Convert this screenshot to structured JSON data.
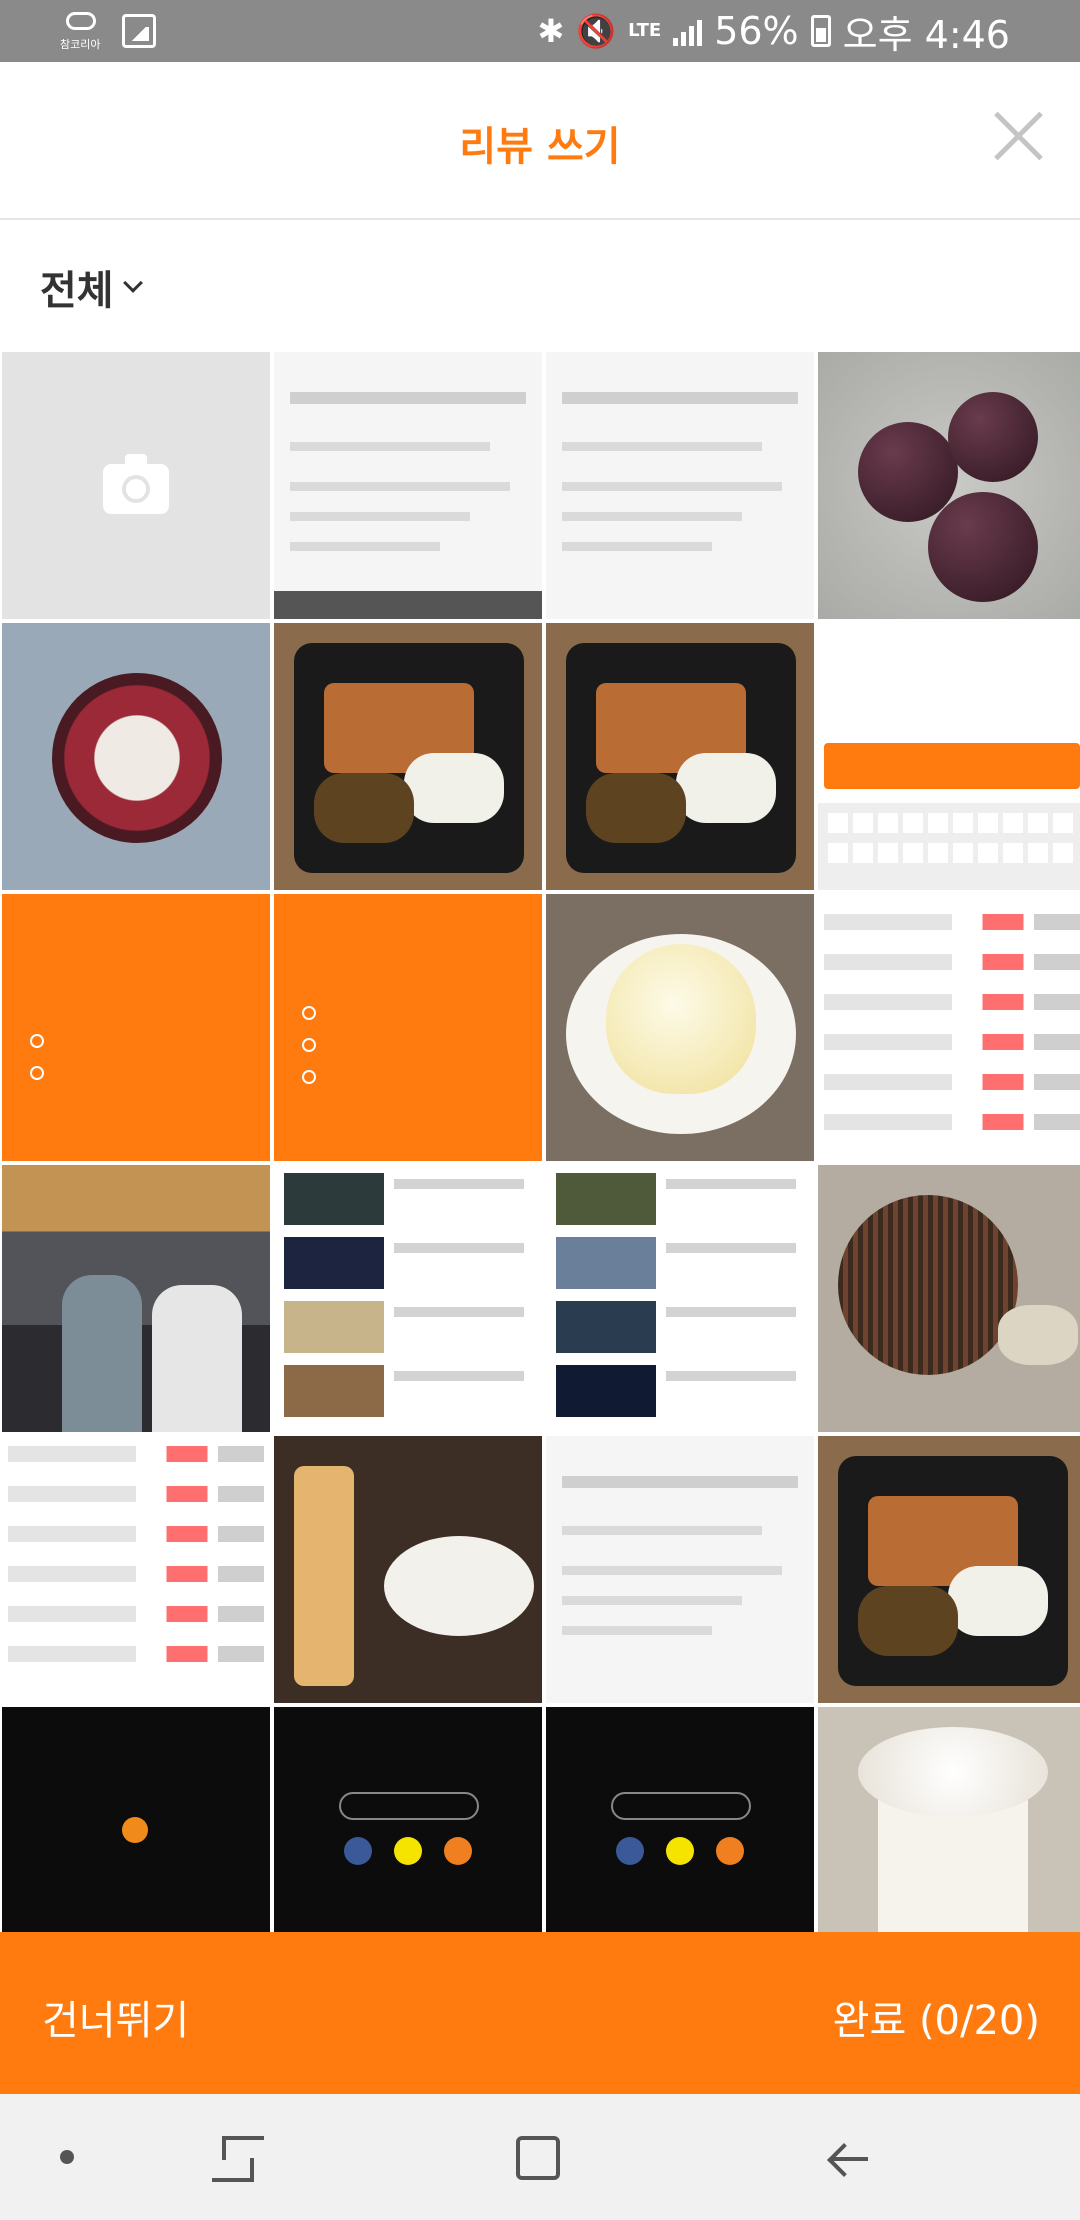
{
  "status_bar": {
    "carrier_label": "참코리아",
    "battery": "56%",
    "network": "LTE",
    "time": "오후 4:46",
    "icons": [
      "carrier-icon",
      "gallery-icon",
      "bluetooth-icon",
      "mute-icon",
      "lte-icon",
      "signal-icon",
      "battery-icon"
    ]
  },
  "header": {
    "title": "리뷰 쓰기",
    "close_icon": "close-icon"
  },
  "filter": {
    "label": "전체",
    "icon": "chevron-down-icon"
  },
  "grid": {
    "columns": 4,
    "tiles": [
      "camera",
      "news-article-screenshot",
      "stock-app-screenshot",
      "mangosteen-photo",
      "mangosteen-open-photo",
      "katsu-curry-photo",
      "katsu-curry-photo",
      "app-keyboard-screenshot",
      "orange-menu-screenshot",
      "orange-menu-screenshot",
      "dessert-photo",
      "crypto-list-screenshot",
      "restaurant-crowd-photo",
      "video-list-screenshot",
      "video-list-screenshot",
      "bbq-grill-photo",
      "board-list-screenshot",
      "cafe-dessert-photo",
      "stock-app-screenshot",
      "katsu-curry-photo",
      "dark-app-screenshot",
      "dark-app-screenshot",
      "dark-app-screenshot",
      "frappe-photo"
    ]
  },
  "actions": {
    "skip_label": "건너뛰기",
    "done_label": "완료 (0/20)"
  },
  "colors": {
    "accent": "#ff7a0f",
    "status_bar": "#8a8a8a",
    "nav_bar": "#f1f1f1"
  },
  "nav_bar": {
    "icons": [
      "dot-icon",
      "recent-apps-icon",
      "home-icon",
      "back-icon"
    ]
  }
}
